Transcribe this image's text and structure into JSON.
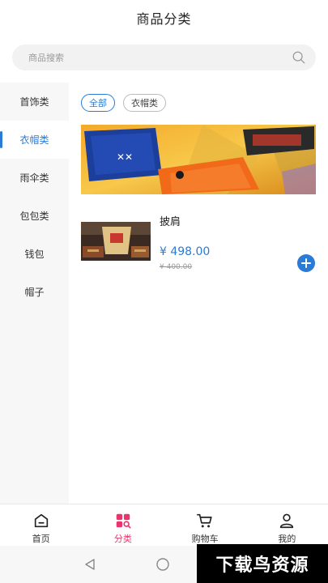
{
  "header": {
    "title": "商品分类"
  },
  "search": {
    "placeholder": "商品搜索"
  },
  "sidebar": {
    "items": [
      {
        "label": "首饰类",
        "active": false
      },
      {
        "label": "衣帽类",
        "active": true
      },
      {
        "label": "雨伞类",
        "active": false
      },
      {
        "label": "包包类",
        "active": false
      },
      {
        "label": "钱包",
        "active": false
      },
      {
        "label": "帽子",
        "active": false
      }
    ]
  },
  "filters": {
    "chips": [
      {
        "label": "全部",
        "active": true
      },
      {
        "label": "衣帽类",
        "active": false
      }
    ]
  },
  "product": {
    "name": "披肩",
    "price": "¥ 498.00",
    "original_price": "¥ 400.00"
  },
  "tabbar": {
    "tabs": [
      {
        "label": "首页",
        "icon": "home-icon",
        "active": false
      },
      {
        "label": "分类",
        "icon": "category-icon",
        "active": true
      },
      {
        "label": "购物车",
        "icon": "cart-icon",
        "active": false
      },
      {
        "label": "我的",
        "icon": "user-icon",
        "active": false
      }
    ]
  },
  "watermark": {
    "text": "下载鸟资源"
  },
  "colors": {
    "accent": "#2a7bd5",
    "tab_active": "#e8356d"
  }
}
